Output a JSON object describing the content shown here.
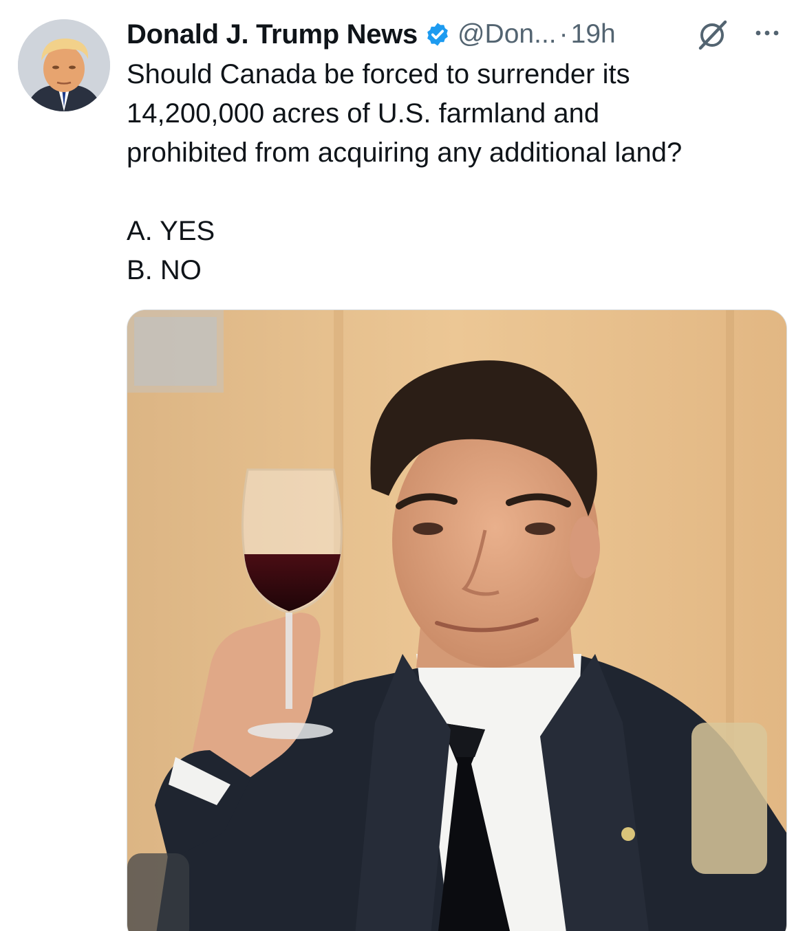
{
  "tweet": {
    "author": {
      "display_name": "Donald J. Trump News",
      "handle": "@Don...",
      "verified_color": "#1d9bf0",
      "avatar_icon": "profile-photo"
    },
    "separator": "·",
    "time": "19h",
    "icons": {
      "grok": "grok-icon",
      "more": "more-options-icon"
    },
    "text_lines": [
      "Should Canada be forced to surrender its",
      "14,200,000 acres of U.S. farmland and",
      "prohibited from acquiring any additional land?"
    ],
    "options": [
      "A. YES",
      "B. NO"
    ],
    "media": {
      "type": "photo"
    }
  },
  "colors": {
    "text": "#0f1419",
    "secondary": "#536471",
    "accent": "#1d9bf0"
  }
}
